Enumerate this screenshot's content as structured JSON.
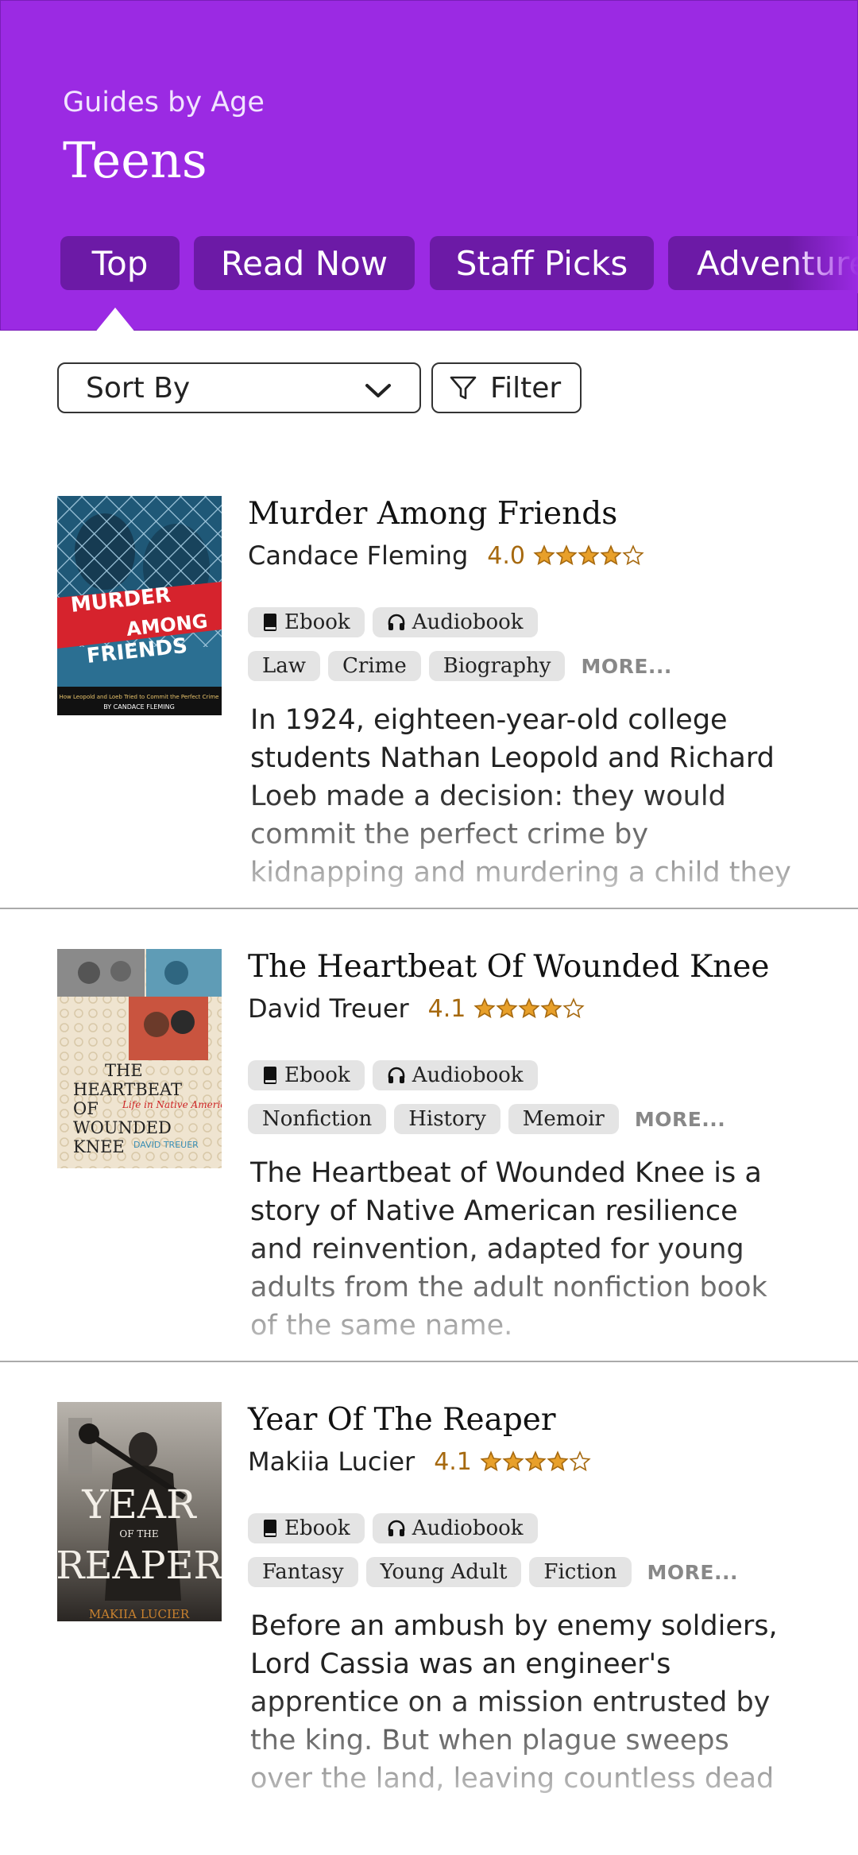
{
  "header": {
    "subtitle": "Guides by Age",
    "title": "Teens",
    "tabs": [
      {
        "label": "Top",
        "active": true
      },
      {
        "label": "Read Now"
      },
      {
        "label": "Staff Picks"
      },
      {
        "label": "Adventure"
      }
    ]
  },
  "controls": {
    "sort_label": "Sort By",
    "filter_label": "Filter"
  },
  "books": [
    {
      "title": "Murder Among Friends",
      "author": "Candace Fleming",
      "rating": "4.0",
      "rating_value": 4.0,
      "formats": [
        "Ebook",
        "Audiobook"
      ],
      "genres": [
        "Law",
        "Crime",
        "Biography"
      ],
      "more": "MORE...",
      "description": "In 1924, eighteen-year-old college students Nathan Leopold and Richard Loeb made a decision: they would commit the perfect crime by kidnapping and murdering a child they both knew.",
      "cover": {
        "line1": "MURDER",
        "line2": "AMONG",
        "line3": "FRIENDS",
        "tagline": "How Leopold and Loeb Tried to Commit the Perfect Crime",
        "byline": "BY CANDACE FLEMING"
      }
    },
    {
      "title": "The Heartbeat Of Wounded Knee",
      "author": "David Treuer",
      "rating": "4.1",
      "rating_value": 4.1,
      "formats": [
        "Ebook",
        "Audiobook"
      ],
      "genres": [
        "Nonfiction",
        "History",
        "Memoir"
      ],
      "more": "MORE...",
      "description": "The Heartbeat of Wounded Knee is a story of Native American resilience and reinvention, adapted for young adults from the adult nonfiction book of the same name.",
      "cover": {
        "line1": "THE",
        "line2": "HEARTBEAT",
        "line3": "OF",
        "line4": "WOUNDED",
        "line5": "KNEE",
        "tagline": "Life in Native America",
        "byline": "DAVID TREUER"
      }
    },
    {
      "title": "Year Of The Reaper",
      "author": "Makiia Lucier",
      "rating": "4.1",
      "rating_value": 4.1,
      "formats": [
        "Ebook",
        "Audiobook"
      ],
      "genres": [
        "Fantasy",
        "Young Adult",
        "Fiction"
      ],
      "more": "MORE...",
      "description": "Before an ambush by enemy soldiers, Lord Cassia was an engineer's apprentice on a mission entrusted by the king. But when plague sweeps over the land, leaving countless dead and",
      "cover": {
        "line1": "YEAR",
        "line2": "OF THE",
        "line3": "REAPER",
        "byline": "MAKIIA LUCIER"
      }
    }
  ],
  "colors": {
    "header_bg": "#9b2ae3",
    "tab_bg": "#6c1aa6",
    "rating": "#a6690f",
    "star": "#e8a02a"
  }
}
